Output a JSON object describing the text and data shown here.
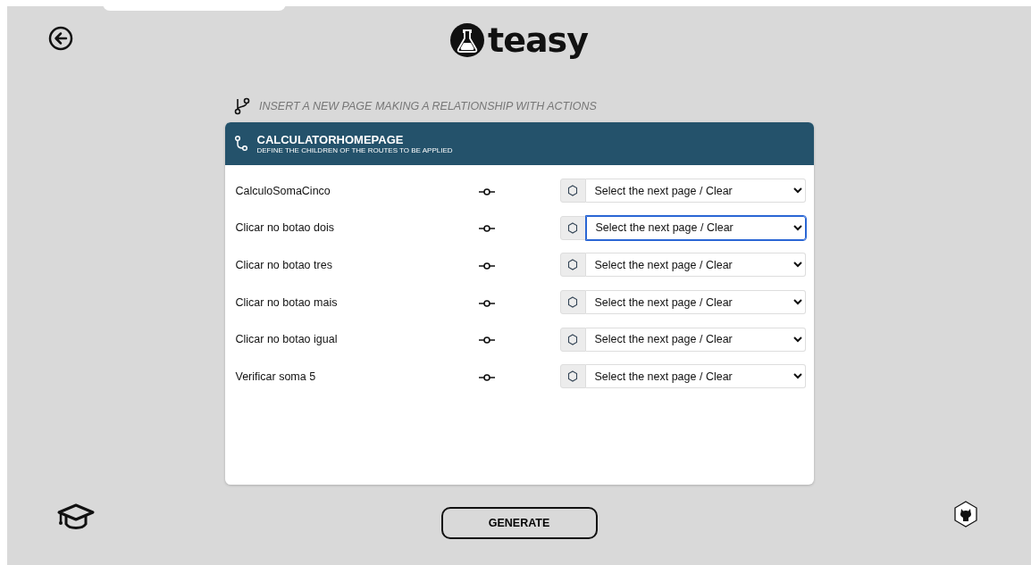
{
  "logo": {
    "text": "teasy"
  },
  "instruction": "INSERT A NEW PAGE MAKING A RELATIONSHIP WITH ACTIONS",
  "card": {
    "title": "CALCULATORHOMEPAGE",
    "subtitle": "DEFINE THE CHILDREN OF THE ROUTES TO BE APPLIED",
    "rows": [
      {
        "action": "CalculoSomaCinco",
        "select": "Select the next page / Clear",
        "focused": false
      },
      {
        "action": "Clicar no botao dois",
        "select": "Select the next page / Clear",
        "focused": true
      },
      {
        "action": "Clicar no botao tres",
        "select": "Select the next page / Clear",
        "focused": false
      },
      {
        "action": "Clicar no botao mais",
        "select": "Select the next page / Clear",
        "focused": false
      },
      {
        "action": "Clicar no botao igual",
        "select": "Select the next page / Clear",
        "focused": false
      },
      {
        "action": "Verificar soma 5",
        "select": "Select the next page / Clear",
        "focused": false
      }
    ]
  },
  "generate_button": "GENERATE"
}
